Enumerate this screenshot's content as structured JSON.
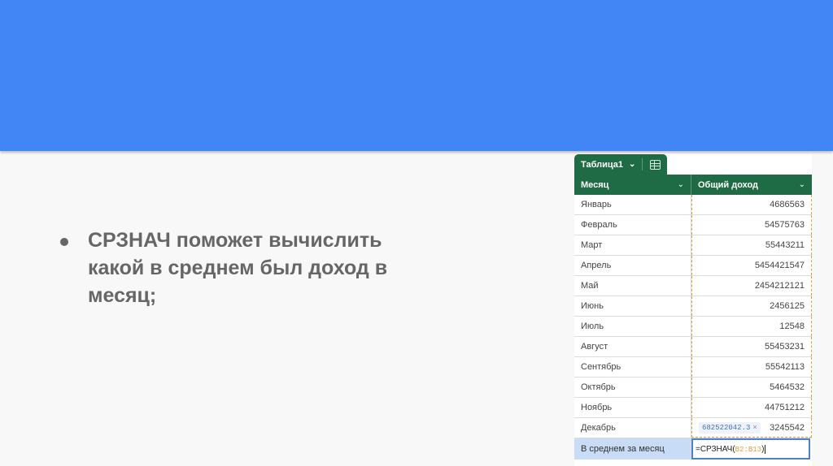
{
  "slide": {
    "bullet_text": "СРЗНАЧ поможет вычислить какой в среднем был доход в месяц;"
  },
  "sheet": {
    "tab_name": "Таблица1",
    "columns": [
      "Месяц",
      "Общий доход"
    ],
    "rows": [
      {
        "month": "Январь",
        "income": "4686563"
      },
      {
        "month": "Февраль",
        "income": "54575763"
      },
      {
        "month": "Март",
        "income": "55443211"
      },
      {
        "month": "Апрель",
        "income": "5454421547"
      },
      {
        "month": "Май",
        "income": "2454212121"
      },
      {
        "month": "Июнь",
        "income": "2456125"
      },
      {
        "month": "Июль",
        "income": "12548"
      },
      {
        "month": "Август",
        "income": "55453231"
      },
      {
        "month": "Сентябрь",
        "income": "55542113"
      },
      {
        "month": "Октябрь",
        "income": "5464532"
      },
      {
        "month": "Ноябрь",
        "income": "44751212"
      },
      {
        "month": "Декабрь",
        "income": "3245542"
      }
    ],
    "preview_value": "682522042.3",
    "preview_close": "×",
    "average_label": "В среднем за месяц",
    "formula_prefix": "=СРЗНАЧ(",
    "formula_range": "B2:B13",
    "formula_suffix": ")"
  },
  "colors": {
    "band": "#4285f4",
    "header_green": "#1e6b45",
    "avg_label_bg": "#c9dcf5",
    "range_highlight": "#d9a23f",
    "active_cell_border": "#4a7fd4"
  }
}
